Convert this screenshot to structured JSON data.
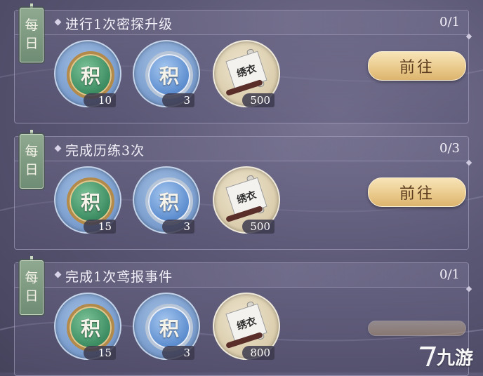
{
  "tasks": [
    {
      "tag": [
        "每",
        "日"
      ],
      "title": "进行1次密探升级",
      "progress": "0/1",
      "rewards": [
        {
          "icon": "green-coin-icon",
          "glyph": "积",
          "qty": "10"
        },
        {
          "icon": "blue-coin-icon",
          "glyph": "积",
          "qty": "3"
        },
        {
          "icon": "scroll-icon",
          "glyph": "绣衣",
          "qty": "500"
        }
      ],
      "button": "前往"
    },
    {
      "tag": [
        "每",
        "日"
      ],
      "title": "完成历练3次",
      "progress": "0/3",
      "rewards": [
        {
          "icon": "green-coin-icon",
          "glyph": "积",
          "qty": "15"
        },
        {
          "icon": "blue-coin-icon",
          "glyph": "积",
          "qty": "3"
        },
        {
          "icon": "scroll-icon",
          "glyph": "绣衣",
          "qty": "500"
        }
      ],
      "button": "前往"
    },
    {
      "tag": [
        "每",
        "日"
      ],
      "title": "完成1次鸢报事件",
      "progress": "0/1",
      "rewards": [
        {
          "icon": "green-coin-icon",
          "glyph": "积",
          "qty": "15"
        },
        {
          "icon": "blue-coin-icon",
          "glyph": "积",
          "qty": "3"
        },
        {
          "icon": "scroll-icon",
          "glyph": "绣衣",
          "qty": "800"
        }
      ],
      "button": ""
    }
  ],
  "watermark": "九游"
}
